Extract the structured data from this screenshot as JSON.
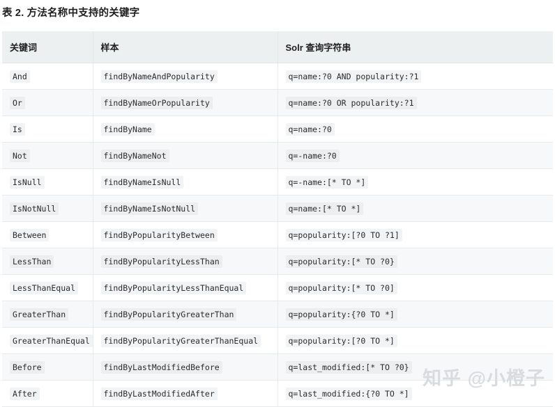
{
  "caption": "表 2. 方法名称中支持的关键字",
  "table": {
    "headers": {
      "keyword": "关键词",
      "sample": "样本",
      "query": "Solr 查询字符串"
    },
    "rows": [
      {
        "keyword": "And",
        "sample": "findByNameAndPopularity",
        "query": "q=name:?0 AND popularity:?1"
      },
      {
        "keyword": "Or",
        "sample": "findByNameOrPopularity",
        "query": "q=name:?0 OR popularity:?1"
      },
      {
        "keyword": "Is",
        "sample": "findByName",
        "query": "q=name:?0"
      },
      {
        "keyword": "Not",
        "sample": "findByNameNot",
        "query": "q=-name:?0"
      },
      {
        "keyword": "IsNull",
        "sample": "findByNameIsNull",
        "query": "q=-name:[* TO *]"
      },
      {
        "keyword": "IsNotNull",
        "sample": "findByNameIsNotNull",
        "query": "q=name:[* TO *]"
      },
      {
        "keyword": "Between",
        "sample": "findByPopularityBetween",
        "query": "q=popularity:[?0 TO ?1]"
      },
      {
        "keyword": "LessThan",
        "sample": "findByPopularityLessThan",
        "query": "q=popularity:[* TO ?0}"
      },
      {
        "keyword": "LessThanEqual",
        "sample": "findByPopularityLessThanEqual",
        "query": "q=popularity:[* TO ?0]"
      },
      {
        "keyword": "GreaterThan",
        "sample": "findByPopularityGreaterThan",
        "query": "q=popularity:{?0 TO *]"
      },
      {
        "keyword": "GreaterThanEqual",
        "sample": "findByPopularityGreaterThanEqual",
        "query": "q=popularity:[?0 TO *]"
      },
      {
        "keyword": "Before",
        "sample": "findByLastModifiedBefore",
        "query": "q=last_modified:[* TO ?0}"
      },
      {
        "keyword": "After",
        "sample": "findByLastModifiedAfter",
        "query": "q=last_modified:{?0 TO *]"
      }
    ]
  },
  "watermark": "知乎 @小橙子",
  "colors": {
    "header_bg": "#edf0f1",
    "row_alt_bg": "#f6f8f9",
    "border": "#e6eaeb",
    "code_bg": "#f2f3f5",
    "watermark": "#d9dcdf",
    "text": "#1f1f1f"
  }
}
